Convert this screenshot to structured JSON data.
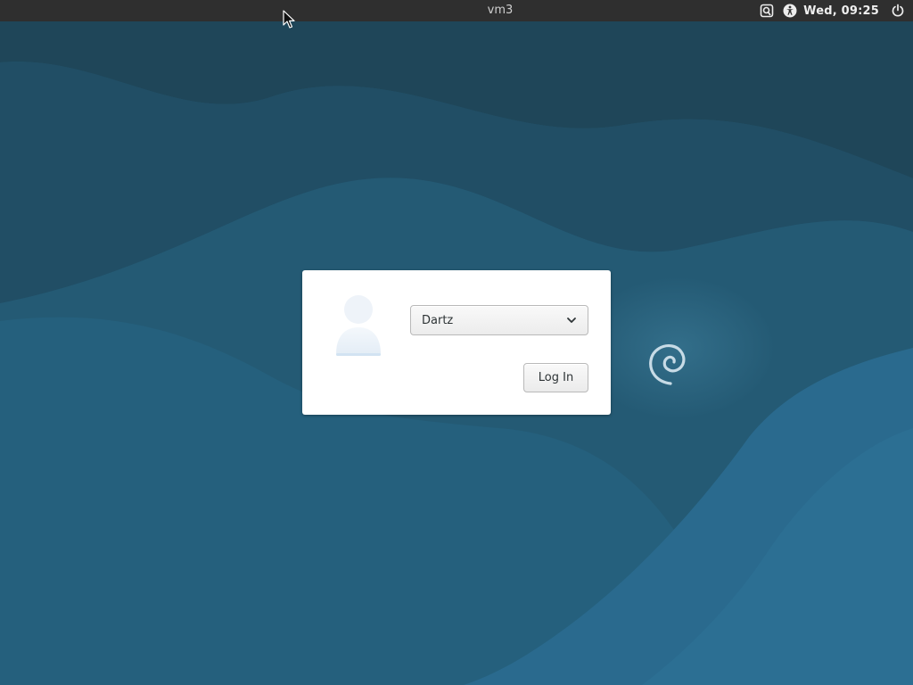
{
  "top_panel": {
    "hostname": "vm3",
    "clock": "Wed, 09:25",
    "icons": [
      "keyboard-layout-icon",
      "accessibility-icon",
      "power-icon"
    ]
  },
  "login_dialog": {
    "avatar_icon": "user-avatar-icon",
    "user_select": {
      "selected": "Dartz"
    },
    "login_button_label": "Log In"
  },
  "desktop": {
    "logo_icon": "debian-swirl-icon"
  },
  "colors": {
    "panel_bg": "#2f2f2f",
    "wallpaper_dark": "#1f4a60",
    "wallpaper_mid": "#24566f",
    "wallpaper_light": "#2a6890",
    "dialog_bg": "#ffffff",
    "text": "#2e3436"
  }
}
